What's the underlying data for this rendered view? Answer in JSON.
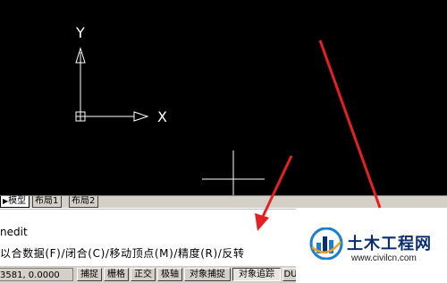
{
  "canvas": {
    "ucs_x_label": "X",
    "ucs_y_label": "Y"
  },
  "tabs": {
    "prev_arrow": "◀",
    "next_arrow": "▶",
    "items": [
      {
        "label": "模型",
        "active": true
      },
      {
        "label": "布局1",
        "active": false
      },
      {
        "label": "布局2",
        "active": false
      }
    ]
  },
  "command": {
    "line1": "nedit",
    "line2": "以合数据(F)/闭合(C)/移动顶点(M)/精度(R)/反转"
  },
  "status": {
    "coords": "3581, 0.0000",
    "buttons": [
      "捕捉",
      "栅格",
      "正交",
      "极轴",
      "对象捕捉",
      "对象追踪",
      "DU"
    ],
    "pressed": [
      "对象追踪"
    ]
  },
  "watermark": {
    "title": "土木工程网",
    "url": "www.civilcn.com"
  },
  "colors": {
    "annotation_arrow": "#e52020",
    "canvas_bg": "#000000",
    "ucs_icon": "#ffffff"
  }
}
